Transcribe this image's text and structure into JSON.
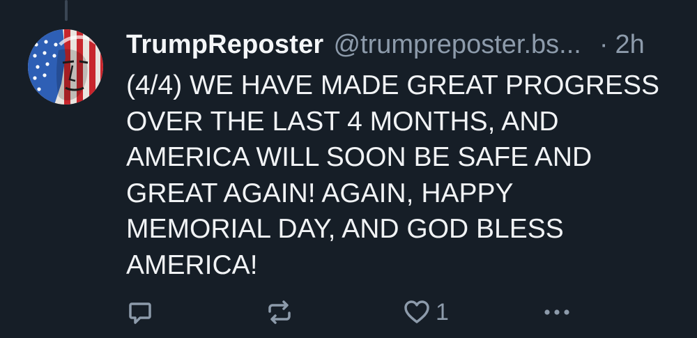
{
  "post": {
    "display_name": "TrumpReposter",
    "handle": "@trumpreposter.bs...",
    "separator": "·",
    "time": "2h",
    "text": "(4/4) WE HAVE MADE GREAT PROGRESS\nOVER THE LAST 4 MONTHS, AND\nAMERICA WILL SOON BE SAFE AND\nGREAT AGAIN! AGAIN, HAPPY\nMEMORIAL DAY, AND GOD BLESS\nAMERICA!",
    "avatar_icon": "flag-portrait-avatar"
  },
  "actions": {
    "reply_icon": "reply-icon",
    "repost_icon": "repost-icon",
    "like_icon": "like-heart-icon",
    "like_count": "1",
    "more_icon": "more-options-icon"
  },
  "colors": {
    "background": "#161e27",
    "text": "#f1f3f5",
    "muted": "#8d9bab",
    "thread_line": "#3a4654"
  }
}
